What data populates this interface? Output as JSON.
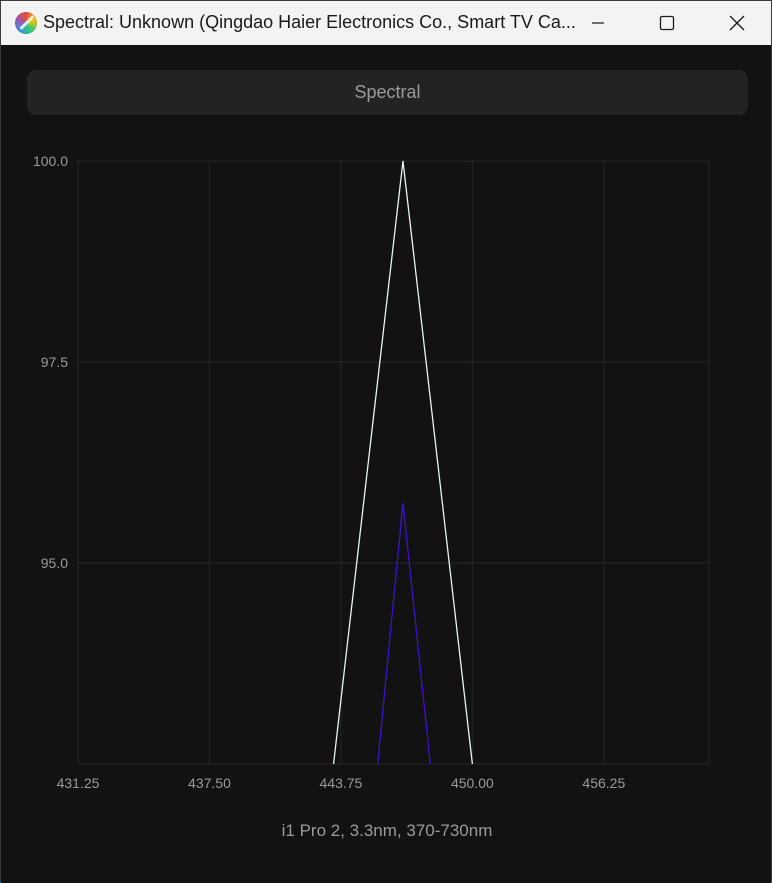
{
  "window": {
    "title": "Spectral: Unknown (Qingdao Haier Electronics Co., Smart TV Ca...",
    "minimize_icon": "minimize-icon",
    "maximize_icon": "maximize-icon",
    "close_icon": "close-icon"
  },
  "tab": {
    "label": "Spectral"
  },
  "chart_data": {
    "type": "line",
    "title": "",
    "xlabel": "",
    "ylabel": "",
    "xlim": [
      431.25,
      461.25
    ],
    "ylim": [
      92.5,
      100.0
    ],
    "x_ticks": [
      "431.25",
      "437.50",
      "443.75",
      "450.00",
      "456.25"
    ],
    "y_ticks": [
      "100.0",
      "97.5",
      "95.0"
    ],
    "grid": true,
    "series": [
      {
        "color": "#e8f6ec",
        "x": [
          443.4,
          446.7,
          450.0
        ],
        "y": [
          92.5,
          100.0,
          92.5
        ]
      },
      {
        "color": "#3b12c8",
        "x": [
          445.5,
          446.7,
          448.0
        ],
        "y": [
          92.5,
          95.75,
          92.5
        ]
      }
    ]
  },
  "footer": {
    "text": "i1 Pro 2, 3.3nm, 370-730nm"
  }
}
